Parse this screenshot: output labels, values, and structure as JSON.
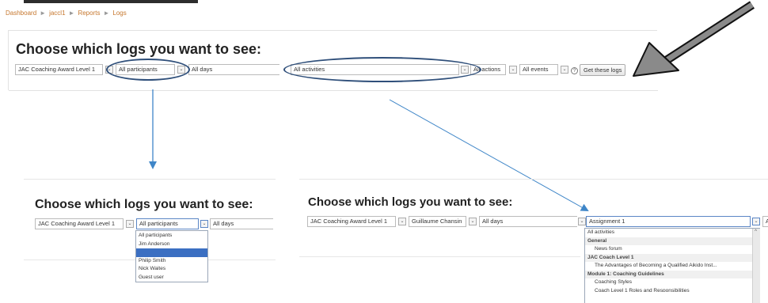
{
  "breadcrumb": [
    "Dashboard",
    "jaccl1",
    "Reports",
    "Logs"
  ],
  "heading": "Choose which logs you want to see:",
  "main": {
    "course": "JAC Coaching Award Level 1",
    "participants": "All participants",
    "days": "All days",
    "activities": "All activities",
    "actions": "All actions",
    "events": "All events",
    "button": "Get these logs"
  },
  "left": {
    "course": "JAC Coaching Award Level 1",
    "participants": "All participants",
    "days": "All days",
    "options": [
      "All participants",
      "Jim Anderson",
      "",
      "Philip Smith",
      "Nick Waites",
      "Guest user"
    ],
    "highlighted_index": 2
  },
  "right": {
    "course": "JAC Coaching Award Level 1",
    "participant": "Guillaume Chansin",
    "days": "All days",
    "activity": "Assignment 1",
    "options": [
      {
        "text": "All activities",
        "kind": "item"
      },
      {
        "text": "General",
        "kind": "group"
      },
      {
        "text": "News forum",
        "kind": "child"
      },
      {
        "text": "JAC Coach Level 1",
        "kind": "group"
      },
      {
        "text": "The Advantages of Becoming a Qualified Aikido Inst...",
        "kind": "child"
      },
      {
        "text": "Module 1: Coaching Guidelines",
        "kind": "group"
      },
      {
        "text": "Coaching Styles",
        "kind": "child"
      },
      {
        "text": "Coach Level 1 Roles and Responsibilities",
        "kind": "child"
      }
    ]
  },
  "colors": {
    "ellipse": "#2f4f7a",
    "connector": "#3f86c8",
    "pointer": "#8a8a8a",
    "highlight": "#3b6fc2"
  }
}
